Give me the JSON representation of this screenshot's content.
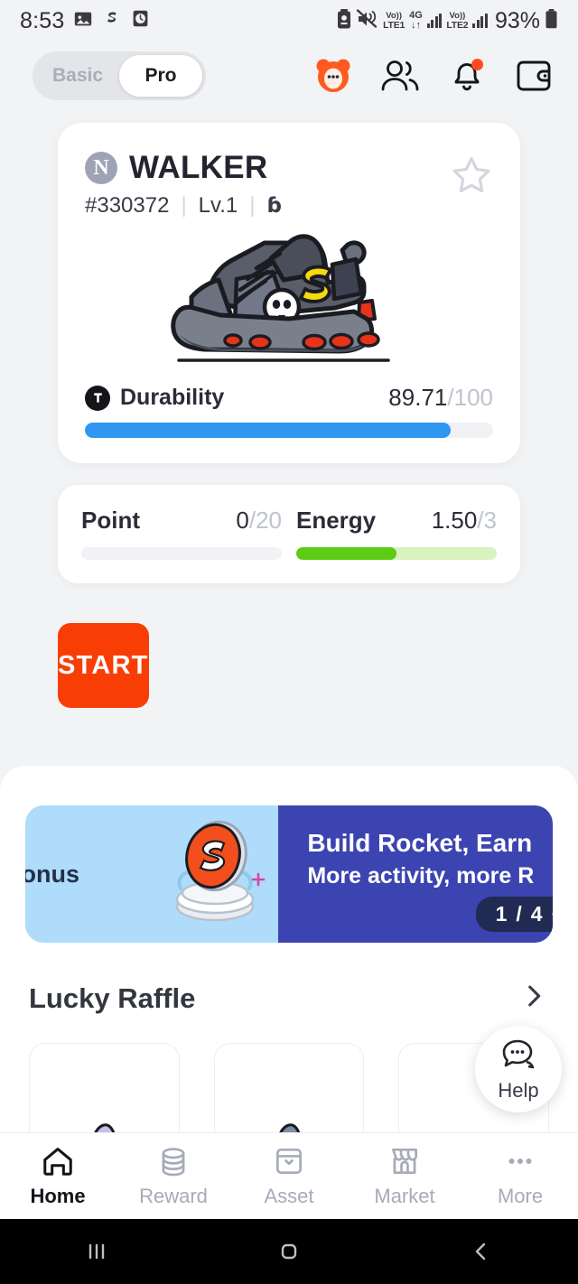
{
  "status_bar": {
    "time": "8:53",
    "left_icons": [
      "gallery-icon",
      "stepn-app-icon",
      "clock-icon"
    ],
    "network": {
      "volte1_top": "Vo))",
      "volte1_bottom": "LTE1",
      "data_tech_top": "4G",
      "data_tech_bottom": "↓↑",
      "volte2_top": "Vo))",
      "volte2_bottom": "LTE2"
    },
    "battery_percent": "93%",
    "right_icons": [
      "battery-saver-icon",
      "mute-icon",
      "signal-bars-icon",
      "battery-icon"
    ]
  },
  "header": {
    "toggle": {
      "options": [
        "Basic",
        "Pro"
      ],
      "selected": "Pro"
    },
    "icons": [
      "mascot-avatar-icon",
      "friends-icon",
      "notification-bell-icon",
      "wallet-icon"
    ],
    "bell_has_notification": true
  },
  "shoe_card": {
    "rarity_letter": "N",
    "name": "WALKER",
    "serial": "#330372",
    "level": "Lv.1",
    "type_glyph": "ɓ",
    "favorite": false,
    "durability": {
      "label": "Durability",
      "value": "89.71",
      "separator": "/",
      "max": "100",
      "percent": 89.71
    }
  },
  "stats": {
    "point": {
      "label": "Point",
      "value": "0",
      "separator": "/",
      "max": "20",
      "percent": 0
    },
    "energy": {
      "label": "Energy",
      "value": "1.50",
      "separator": "/",
      "max": "3",
      "percent": 50
    }
  },
  "start_button": {
    "label": "START"
  },
  "banner": {
    "left_text": "Bonus",
    "title": "Build Rocket, Earn",
    "subtitle": "More activity, more R",
    "pager_current": "1",
    "pager_divider": "/",
    "pager_total": "4",
    "pager_plus": "+"
  },
  "lucky_raffle": {
    "title": "Lucky Raffle",
    "arrow": "chevron-right-icon"
  },
  "help_fab": {
    "label": "Help",
    "icon": "chat-bubble-icon"
  },
  "bottom_nav": {
    "items": [
      {
        "label": "Home",
        "icon": "home-icon",
        "active": true
      },
      {
        "label": "Reward",
        "icon": "coins-icon",
        "active": false
      },
      {
        "label": "Asset",
        "icon": "box-icon",
        "active": false
      },
      {
        "label": "Market",
        "icon": "store-icon",
        "active": false
      },
      {
        "label": "More",
        "icon": "ellipsis-icon",
        "active": false
      }
    ]
  },
  "android_nav": {
    "items": [
      "recents-icon",
      "home-icon",
      "back-icon"
    ]
  },
  "colors": {
    "page_bg": "#F2F3F5",
    "accent_orange": "#F93E05",
    "durability_blue": "#2F97F2",
    "energy_green": "#5CCC14",
    "banner_indigo": "#3B44B0",
    "banner_lightblue": "#AEDCFA"
  }
}
